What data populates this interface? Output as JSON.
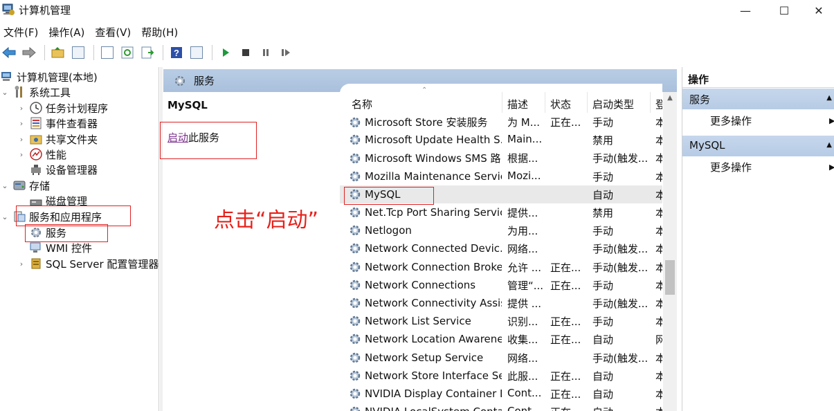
{
  "window": {
    "title": "计算机管理",
    "controls": {
      "minimize": "—",
      "maximize": "☐",
      "close": "✕"
    }
  },
  "menu": [
    "文件(F)",
    "操作(A)",
    "查看(V)",
    "帮助(H)"
  ],
  "toolbar": [
    "back-arrow-icon",
    "forward-arrow-icon",
    "up-folder-icon",
    "show-tree-icon",
    "properties-icon",
    "refresh-icon",
    "export-list-icon",
    "help-icon",
    "show-action-pane-icon",
    "play-icon",
    "stop-icon",
    "pause-icon",
    "restart-icon"
  ],
  "tree": {
    "root": "计算机管理(本地)",
    "system_tools": "系统工具",
    "task_scheduler": "任务计划程序",
    "event_viewer": "事件查看器",
    "shared_folders": "共享文件夹",
    "performance": "性能",
    "device_manager": "设备管理器",
    "storage": "存储",
    "disk_management": "磁盘管理",
    "services_apps": "服务和应用程序",
    "services": "服务",
    "wmi": "WMI 控件",
    "sql_config": "SQL Server 配置管理器"
  },
  "middle": {
    "header_title": "服务",
    "selected_service": "MySQL",
    "start_link": "启动",
    "start_suffix": "此服务",
    "annotation": "点击“启动”"
  },
  "list": {
    "columns": {
      "name": "名称",
      "desc": "描述",
      "status": "状态",
      "startup": "启动类型",
      "login": "登"
    },
    "rows": [
      {
        "name": "Microsoft Store 安装服务",
        "desc": "为 M...",
        "status": "正在...",
        "startup": "手动",
        "login": "本"
      },
      {
        "name": "Microsoft Update Health S...",
        "desc": "Main...",
        "status": "",
        "startup": "禁用",
        "login": "本"
      },
      {
        "name": "Microsoft Windows SMS 路...",
        "desc": "根据...",
        "status": "",
        "startup": "手动(触发...",
        "login": "本"
      },
      {
        "name": "Mozilla Maintenance Service",
        "desc": "Mozi...",
        "status": "",
        "startup": "手动",
        "login": "本"
      },
      {
        "name": "MySQL",
        "desc": "",
        "status": "",
        "startup": "自动",
        "login": "本",
        "selected": true
      },
      {
        "name": "Net.Tcp Port Sharing Service",
        "desc": "提供...",
        "status": "",
        "startup": "禁用",
        "login": "本"
      },
      {
        "name": "Netlogon",
        "desc": "为用...",
        "status": "",
        "startup": "手动",
        "login": "本"
      },
      {
        "name": "Network Connected Devic...",
        "desc": "网络...",
        "status": "",
        "startup": "手动(触发...",
        "login": "本"
      },
      {
        "name": "Network Connection Broker",
        "desc": "允许 ...",
        "status": "正在...",
        "startup": "手动(触发...",
        "login": "本"
      },
      {
        "name": "Network Connections",
        "desc": "管理“...",
        "status": "正在...",
        "startup": "手动",
        "login": "本"
      },
      {
        "name": "Network Connectivity Assis...",
        "desc": "提供 ...",
        "status": "",
        "startup": "手动(触发...",
        "login": "本"
      },
      {
        "name": "Network List Service",
        "desc": "识别...",
        "status": "正在...",
        "startup": "手动",
        "login": "本"
      },
      {
        "name": "Network Location Awarene...",
        "desc": "收集...",
        "status": "正在...",
        "startup": "自动",
        "login": "网"
      },
      {
        "name": "Network Setup Service",
        "desc": "网络...",
        "status": "",
        "startup": "手动(触发...",
        "login": "本"
      },
      {
        "name": "Network Store Interface Se...",
        "desc": "此服...",
        "status": "正在...",
        "startup": "自动",
        "login": "本"
      },
      {
        "name": "NVIDIA Display Container LS",
        "desc": "Cont...",
        "status": "正在...",
        "startup": "自动",
        "login": "本"
      },
      {
        "name": "NVIDIA LocalSystem Conta...",
        "desc": "Cont...",
        "status": "正在...",
        "startup": "自动",
        "login": "本"
      }
    ]
  },
  "actions": {
    "title": "操作",
    "sections": [
      {
        "header": "服务",
        "item": "更多操作"
      },
      {
        "header": "MySQL",
        "item": "更多操作"
      }
    ]
  },
  "colors": {
    "annotation": "#e8201a",
    "header_blue": "#b9cde5",
    "link": "#7a2e8c"
  }
}
